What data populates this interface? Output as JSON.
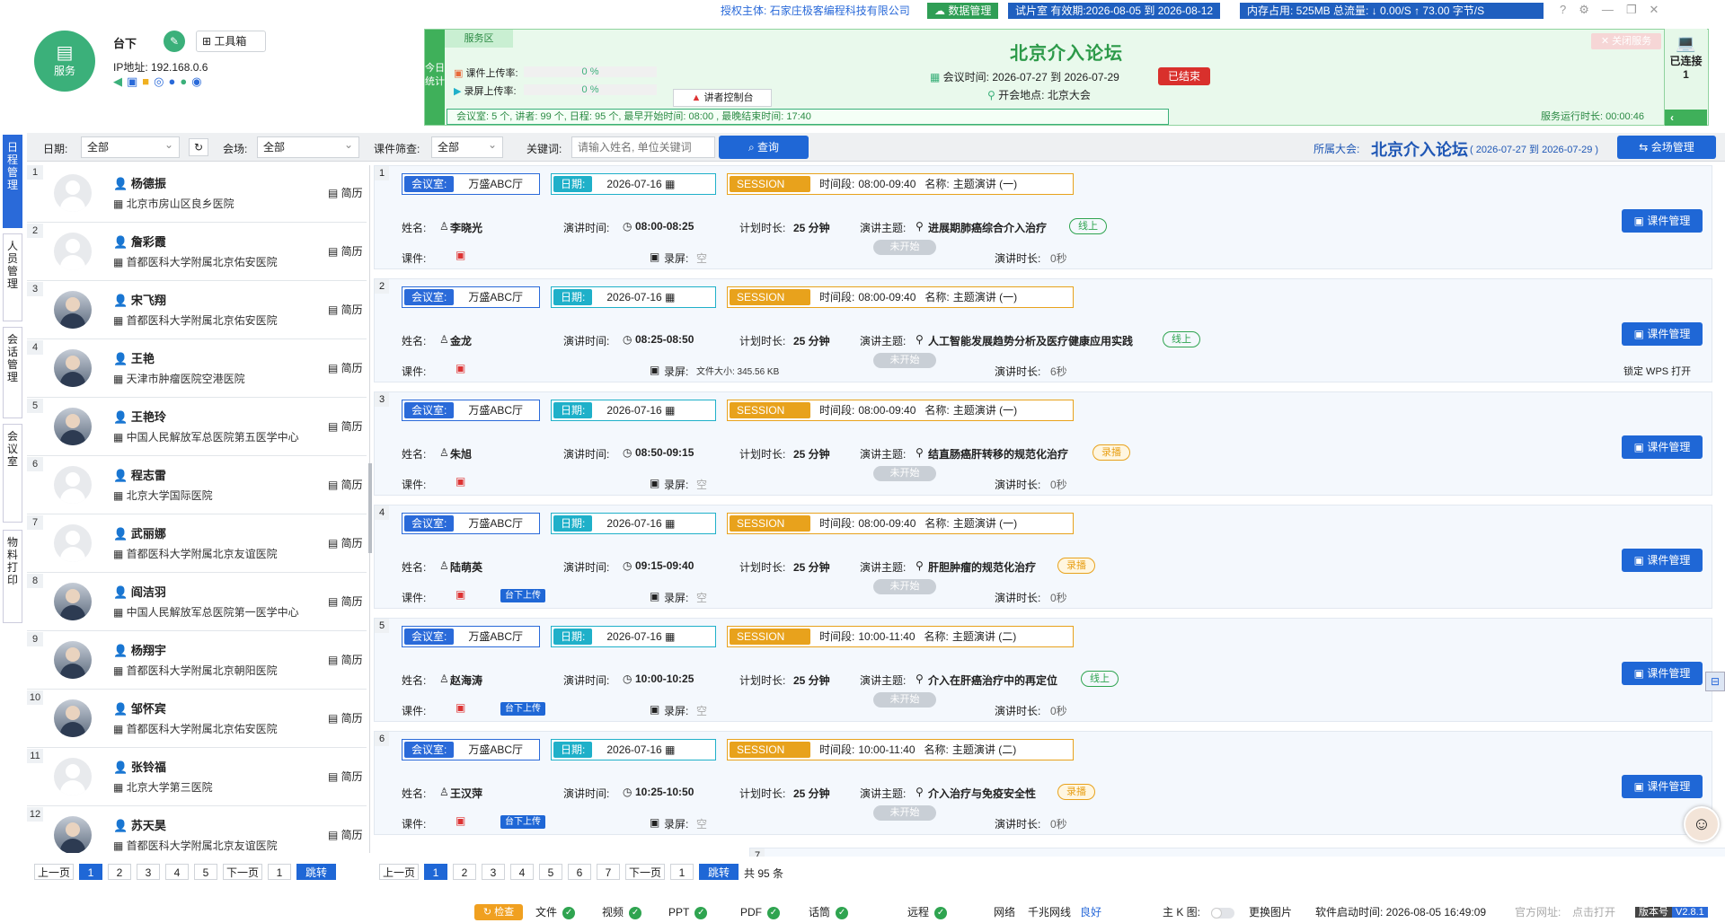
{
  "header": {
    "service_label": "服务",
    "stage": "台下",
    "toolbox": "工具箱",
    "ip_label": "IP地址: 192.168.0.6",
    "auth_label": "授权主体:",
    "auth_org": "石家庄极客编程科技有限公司",
    "data_mgmt": "数据管理",
    "trial": "试片室 有效期:2026-08-05 到 2026-08-12",
    "mem": "内存占用: 525MB",
    "flow": "总流量: ↓ 0.00/S   ↑ 73.00 字节/S"
  },
  "forum": {
    "title": "北京介入论坛",
    "service_area": "服务区",
    "close_service": "关闭服务",
    "today_stats": "今日统计",
    "course_upload": "课件上传率:",
    "course_pct": "0 %",
    "rec_upload": "录屏上传率:",
    "rec_pct": "0 %",
    "speaker_console": "讲者控制台",
    "meeting_time_label": "会议时间:",
    "start": "2026-07-27",
    "to": "到",
    "end": "2026-07-29",
    "ended": "已结束",
    "place_label": "开会地点:",
    "place": "北京大会",
    "summary": "会议室:  5 个,  讲者:  99 个,  日程:  95 个,  最早开始时间:  08:00 ,   最晚结束时间:  17:40",
    "runtime": "服务运行时长: 00:00:46",
    "connected": "已连接",
    "connected_count": "1"
  },
  "toolbar": {
    "date_label": "日期:",
    "date_val": "全部",
    "venue_label": "会场:",
    "venue_val": "全部",
    "course_label": "课件筛查:",
    "course_val": "全部",
    "kw_label": "关键词:",
    "kw_placeholder": "请输入姓名, 单位关键词",
    "query": "查询",
    "belong_label": "所属大会:",
    "belong_name": "北京介入论坛",
    "belong_range": "( 2026-07-27 到 2026-07-29 )",
    "venue_mgmt": "会场管理"
  },
  "tabs": [
    "日程管理",
    "人员管理",
    "会话管理",
    "会议室",
    "物料打印"
  ],
  "speakers": [
    {
      "n": "1",
      "name": "杨德振",
      "hosp": "北京市房山区良乡医院",
      "photo": false
    },
    {
      "n": "2",
      "name": "詹彩霞",
      "hosp": "首都医科大学附属北京佑安医院",
      "photo": false
    },
    {
      "n": "3",
      "name": "宋飞翔",
      "hosp": "首都医科大学附属北京佑安医院",
      "photo": true
    },
    {
      "n": "4",
      "name": "王艳",
      "hosp": "天津市肿瘤医院空港医院",
      "photo": true
    },
    {
      "n": "5",
      "name": "王艳玲",
      "hosp": "中国人民解放军总医院第五医学中心",
      "photo": true
    },
    {
      "n": "6",
      "name": "程志雷",
      "hosp": "北京大学国际医院",
      "photo": false
    },
    {
      "n": "7",
      "name": "武丽娜",
      "hosp": "首都医科大学附属北京友谊医院",
      "photo": false
    },
    {
      "n": "8",
      "name": "阎洁羽",
      "hosp": "中国人民解放军总医院第一医学中心",
      "photo": true
    },
    {
      "n": "9",
      "name": "杨翔宇",
      "hosp": "首都医科大学附属北京朝阳医院",
      "photo": true
    },
    {
      "n": "10",
      "name": "邹怀宾",
      "hosp": "首都医科大学附属北京佑安医院",
      "photo": true
    },
    {
      "n": "11",
      "name": "张铃福",
      "hosp": "北京大学第三医院",
      "photo": false
    },
    {
      "n": "12",
      "name": "苏天昊",
      "hosp": "首都医科大学附属北京友谊医院",
      "photo": true
    }
  ],
  "resume_label": "简历",
  "labels": {
    "room": "会议室:",
    "date": "日期:",
    "session": "SESSION",
    "slot": "时间段:",
    "title": "名称:",
    "name": "姓名:",
    "speech_time": "演讲时间:",
    "plan": "计划时长:",
    "topic": "演讲主题:",
    "course": "课件:",
    "rec": "录屏:",
    "not_started": "未开始",
    "dur": "演讲时长:",
    "manage": "课件管理",
    "upload": "台下上传",
    "empty": "空"
  },
  "sessions": [
    {
      "n": "1",
      "room": "万盛ABC厅",
      "date": "2026-07-16",
      "slot": "08:00-09:40",
      "title": "主题演讲 (一)",
      "name": "李晓光",
      "time": "08:00-08:25",
      "plan": "25 分钟",
      "topic": "进展期肺癌综合介入治疗",
      "mode": "线上",
      "mode_type": "green",
      "rec": "空",
      "dur": "0秒",
      "upload": false
    },
    {
      "n": "2",
      "room": "万盛ABC厅",
      "date": "2026-07-16",
      "slot": "08:00-09:40",
      "title": "主题演讲 (一)",
      "name": "金龙",
      "time": "08:25-08:50",
      "plan": "25 分钟",
      "topic": "人工智能发展趋势分析及医疗健康应用实践",
      "mode": "线上",
      "mode_type": "green",
      "rec": "文件大小: 345.56 KB",
      "dur": "6秒",
      "upload": false,
      "wps": "锁定 WPS 打开"
    },
    {
      "n": "3",
      "room": "万盛ABC厅",
      "date": "2026-07-16",
      "slot": "08:00-09:40",
      "title": "主题演讲 (一)",
      "name": "朱旭",
      "time": "08:50-09:15",
      "plan": "25 分钟",
      "topic": "结直肠癌肝转移的规范化治疗",
      "mode": "录播",
      "mode_type": "ora",
      "rec": "空",
      "dur": "0秒",
      "upload": false
    },
    {
      "n": "4",
      "room": "万盛ABC厅",
      "date": "2026-07-16",
      "slot": "08:00-09:40",
      "title": "主题演讲 (一)",
      "name": "陆萌英",
      "time": "09:15-09:40",
      "plan": "25 分钟",
      "topic": "肝胆肿瘤的规范化治疗",
      "mode": "录播",
      "mode_type": "ora",
      "rec": "空",
      "dur": "0秒",
      "upload": true
    },
    {
      "n": "5",
      "room": "万盛ABC厅",
      "date": "2026-07-16",
      "slot": "10:00-11:40",
      "title": "主题演讲 (二)",
      "name": "赵海涛",
      "time": "10:00-10:25",
      "plan": "25 分钟",
      "topic": "介入在肝癌治疗中的再定位",
      "mode": "线上",
      "mode_type": "green",
      "rec": "空",
      "dur": "0秒",
      "upload": true
    },
    {
      "n": "6",
      "room": "万盛ABC厅",
      "date": "2026-07-16",
      "slot": "10:00-11:40",
      "title": "主题演讲 (二)",
      "name": "王汉萍",
      "time": "10:25-10:50",
      "plan": "25 分钟",
      "topic": "介入治疗与免疫安全性",
      "mode": "录播",
      "mode_type": "ora",
      "rec": "空",
      "dur": "0秒",
      "upload": true
    }
  ],
  "pager_left": {
    "prev": "上一页",
    "pages": [
      "1",
      "2",
      "3",
      "4",
      "5"
    ],
    "next": "下一页",
    "input": "1",
    "jump": "跳转"
  },
  "pager_right": {
    "prev": "上一页",
    "pages": [
      "1",
      "2",
      "3",
      "4",
      "5",
      "6",
      "7"
    ],
    "next": "下一页",
    "input": "1",
    "jump": "跳转",
    "total": "共 95 条"
  },
  "footer": {
    "check": "检查",
    "items": [
      "文件",
      "视频",
      "PPT",
      "PDF",
      "话筒",
      "远程"
    ],
    "net": "网络",
    "net_type": "千兆网线",
    "net_status": "良好",
    "k": "主 K 图:",
    "swap": "更换图片",
    "start_time": "软件启动时间: 2026-08-05 16:49:09",
    "site": "官方网址:",
    "site_val": "点击打开",
    "ver_label": "版本号",
    "ver": "V2.8.1"
  }
}
